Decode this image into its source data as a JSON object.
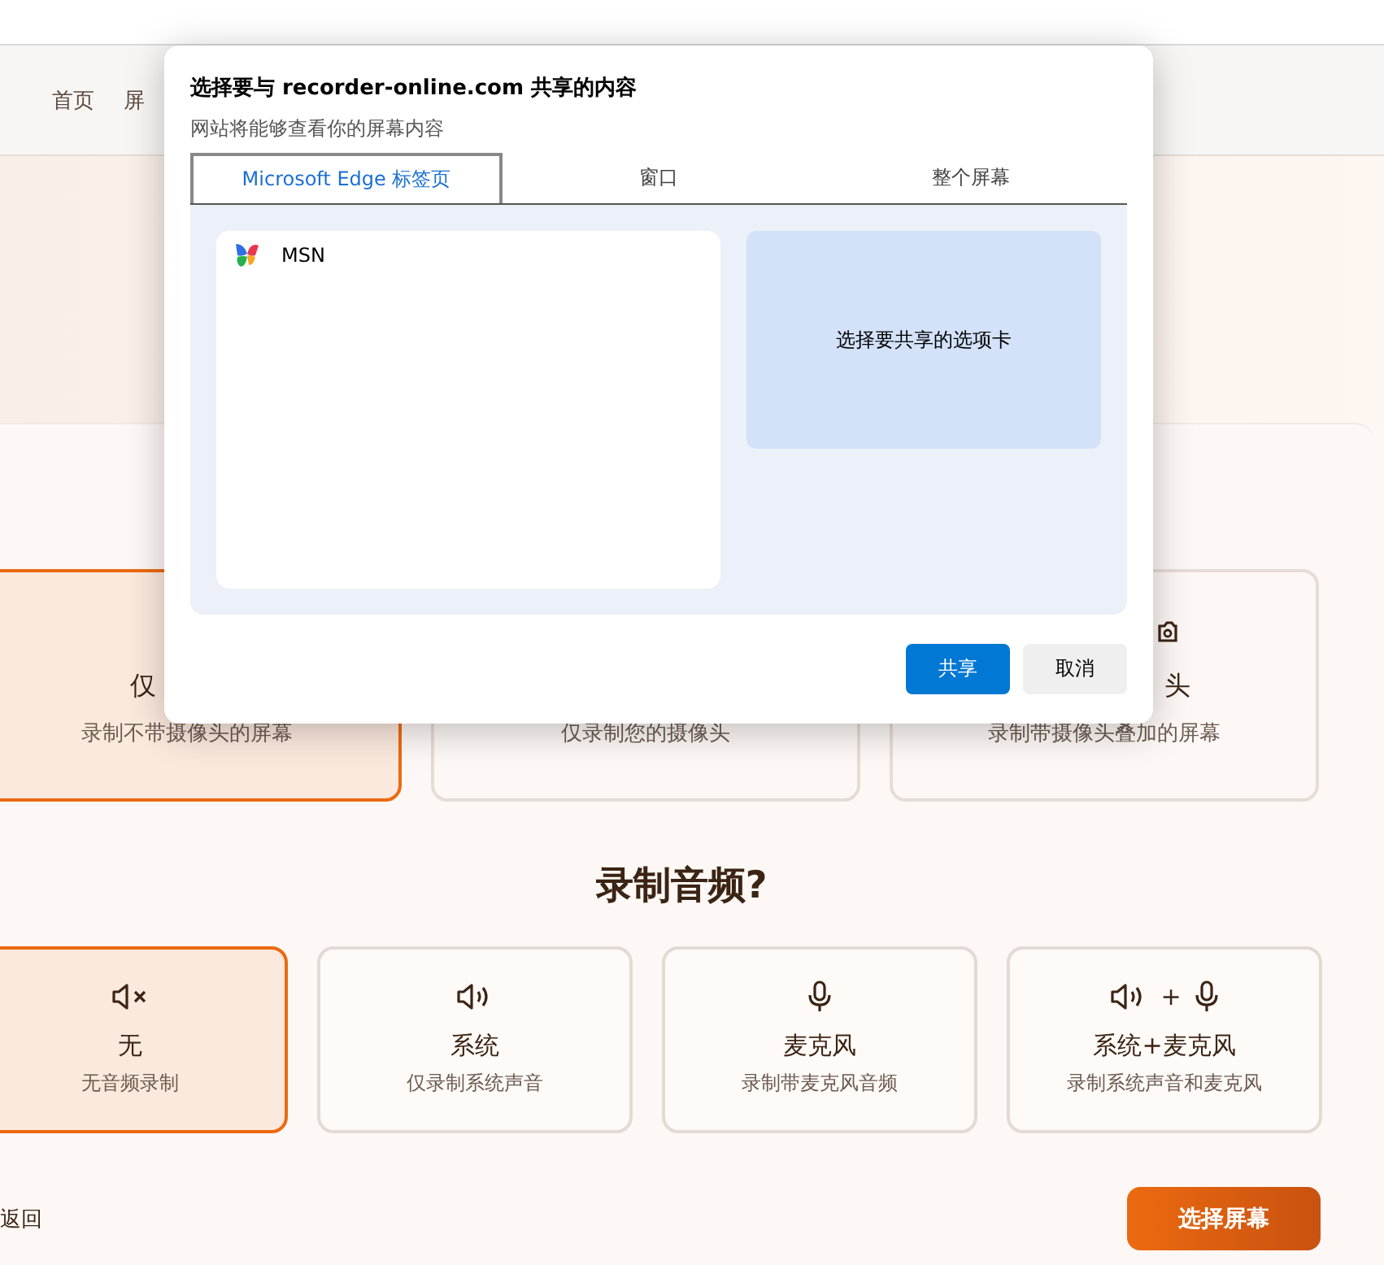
{
  "nav": {
    "items": [
      {
        "label": "首页"
      },
      {
        "label": "屏"
      }
    ]
  },
  "video_options": [
    {
      "title": "仅",
      "description": "录制不带摄像头的屏幕",
      "selected": true
    },
    {
      "description": "仅录制您的摄像头",
      "selected": false
    },
    {
      "title": "头",
      "description": "录制带摄像头叠加的屏幕",
      "selected": false
    }
  ],
  "audio_heading": "录制音频?",
  "audio_options": [
    {
      "kind": "none",
      "title": "无",
      "description": "无音频录制",
      "selected": true
    },
    {
      "kind": "system",
      "title": "系统",
      "description": "仅录制系统声音",
      "selected": false
    },
    {
      "kind": "mic",
      "title": "麦克风",
      "description": "录制带麦克风音频",
      "selected": false
    },
    {
      "kind": "system_mic",
      "joiner": "+",
      "title": "系统+麦克风",
      "description": "录制系统声音和麦克风",
      "selected": false
    }
  ],
  "back_link": "返回",
  "primary_button": "选择屏幕",
  "dialog": {
    "title": "选择要与 recorder-online.com 共享的内容",
    "subtitle": "网站将能够查看你的屏幕内容",
    "tabs": [
      {
        "label": "Microsoft Edge 标签页",
        "selected": true
      },
      {
        "label": "窗口",
        "selected": false
      },
      {
        "label": "整个屏幕",
        "selected": false
      }
    ],
    "tab_list": [
      {
        "title": "MSN"
      }
    ],
    "preview_hint": "选择要共享的选项卡",
    "buttons": [
      {
        "kind": "primary",
        "label": "共享"
      },
      {
        "kind": "secondary",
        "label": "取消"
      }
    ]
  }
}
